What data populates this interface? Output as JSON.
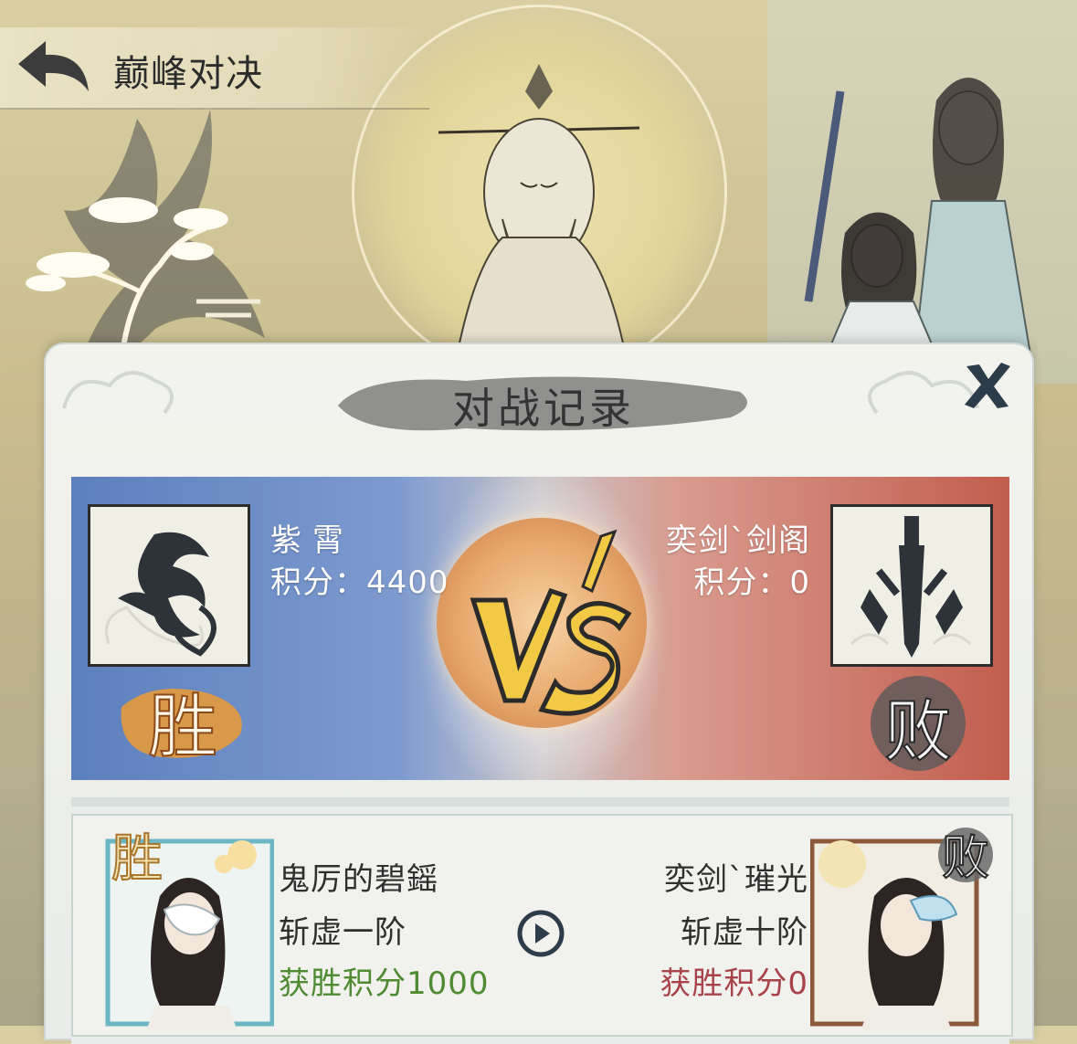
{
  "header": {
    "back_icon": "back-arrow-icon",
    "title": "巅峰对决"
  },
  "modal": {
    "title": "对战记录",
    "close_icon": "close-x-icon"
  },
  "match": {
    "left_player": {
      "name": "紫霄",
      "score_text": "积分：4400",
      "emblem_icon": "dragon-emblem-icon",
      "result_label": "胜"
    },
    "right_player": {
      "name": "奕剑ˋ剑阁",
      "score_text": "积分：0",
      "emblem_icon": "sword-emblem-icon",
      "result_label": "败"
    },
    "vs_label": "VS"
  },
  "battle": {
    "left": {
      "name": "鬼厉的碧鎐",
      "rank": "斩虚一阶",
      "points": "获胜积分1000",
      "badge": "胜"
    },
    "right": {
      "name": "奕剑ˋ璀光",
      "rank": "斩虚十阶",
      "points": "获胜积分0",
      "badge": "败"
    },
    "replay_icon": "play-icon"
  },
  "colors": {
    "win_green": "#4e8b32",
    "lose_red": "#a8434a",
    "left_blue": "#5d7fbd",
    "right_red": "#c25d4f"
  }
}
